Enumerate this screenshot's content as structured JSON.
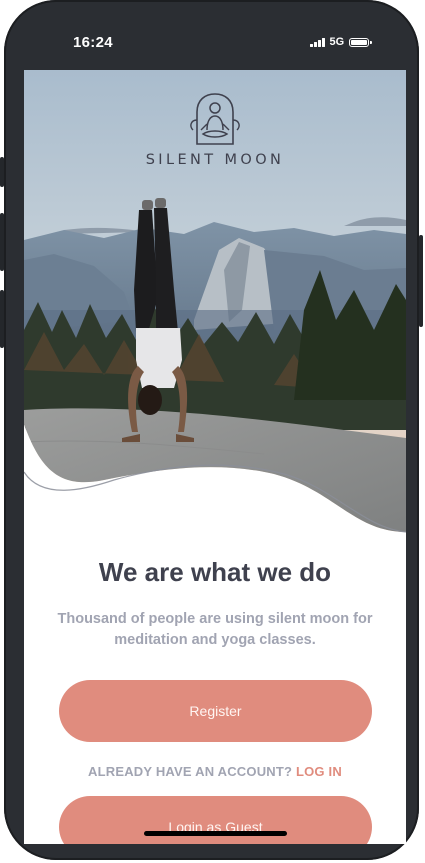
{
  "status_bar": {
    "time": "16:24",
    "network": "5G",
    "icons": [
      "signal-icon",
      "battery-icon"
    ]
  },
  "brand": {
    "name": "SILENT MOON",
    "logo_icon": "meditating-figure-icon"
  },
  "hero": {
    "image": "handstand-on-mountain-photo"
  },
  "onboarding": {
    "title": "We are what we do",
    "subtitle": "Thousand of people are using silent moon for meditation and yoga classes."
  },
  "actions": {
    "register_label": "Register",
    "login_prompt": "ALREADY HAVE AN ACCOUNT?",
    "login_link": "LOG IN",
    "guest_label": "Login as Guest"
  },
  "colors": {
    "accent": "#E08C7E",
    "heading": "#3F414E",
    "muted": "#A1A4B2",
    "frame": "#2B2E33"
  }
}
